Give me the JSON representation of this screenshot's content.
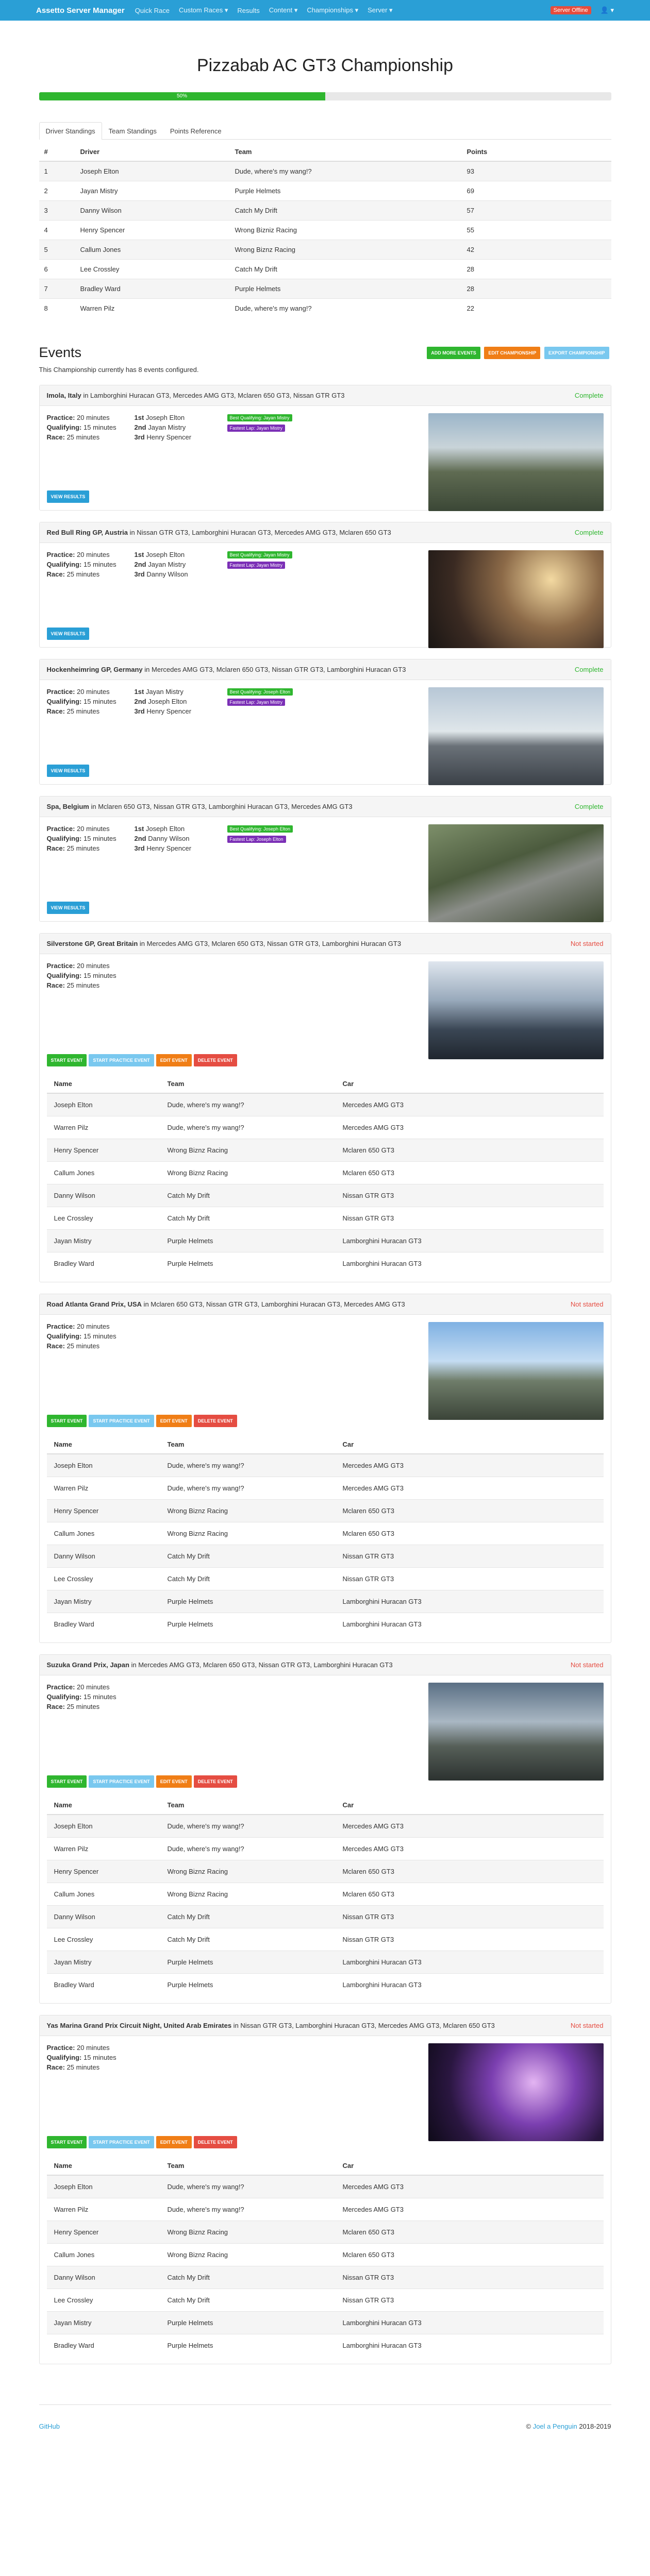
{
  "nav": {
    "brand": "Assetto Server Manager",
    "items": [
      "Quick Race",
      "Custom Races ▾",
      "Results",
      "Content ▾",
      "Championships ▾",
      "Server ▾"
    ],
    "status": "Server Offline",
    "user": "👤 ▾"
  },
  "page": {
    "title": "Pizzabab AC GT3 Championship",
    "progress_pct": 50,
    "progress_label": "50%"
  },
  "standings": {
    "tabs": [
      "Driver Standings",
      "Team Standings",
      "Points Reference"
    ],
    "headers": [
      "#",
      "Driver",
      "Team",
      "Points"
    ],
    "rows": [
      [
        "1",
        "Joseph Elton",
        "Dude, where's my wang!?",
        "93"
      ],
      [
        "2",
        "Jayan Mistry",
        "Purple Helmets",
        "69"
      ],
      [
        "3",
        "Danny Wilson",
        "Catch My Drift",
        "57"
      ],
      [
        "4",
        "Henry Spencer",
        "Wrong Bizniz Racing",
        "55"
      ],
      [
        "5",
        "Callum Jones",
        "Wrong Biznz Racing",
        "42"
      ],
      [
        "6",
        "Lee Crossley",
        "Catch My Drift",
        "28"
      ],
      [
        "7",
        "Bradley Ward",
        "Purple Helmets",
        "28"
      ],
      [
        "8",
        "Warren Pilz",
        "Dude, where's my wang!?",
        "22"
      ]
    ]
  },
  "events": {
    "title": "Events",
    "subtitle": "This Championship currently has 8 events configured.",
    "buttons": {
      "add": "Add more events",
      "edit": "Edit Championship",
      "export": "Export Championship"
    },
    "labels": {
      "practice": "Practice:",
      "qualifying": "Qualifying:",
      "race": "Race:",
      "first": "1st",
      "second": "2nd",
      "third": "3rd",
      "view_results": "View Results",
      "start_event": "Start Event",
      "start_practice": "Start Practice Event",
      "edit_event": "Edit Event",
      "delete_event": "Delete Event"
    },
    "entrant_headers": [
      "Name",
      "Team",
      "Car"
    ],
    "entrants": [
      [
        "Joseph Elton",
        "Dude, where's my wang!?",
        "Mercedes AMG GT3"
      ],
      [
        "Warren Pilz",
        "Dude, where's my wang!?",
        "Mercedes AMG GT3"
      ],
      [
        "Henry Spencer",
        "Wrong Biznz Racing",
        "Mclaren 650 GT3"
      ],
      [
        "Callum Jones",
        "Wrong Biznz Racing",
        "Mclaren 650 GT3"
      ],
      [
        "Danny Wilson",
        "Catch My Drift",
        "Nissan GTR GT3"
      ],
      [
        "Lee Crossley",
        "Catch My Drift",
        "Nissan GTR GT3"
      ],
      [
        "Jayan Mistry",
        "Purple Helmets",
        "Lamborghini Huracan GT3"
      ],
      [
        "Bradley Ward",
        "Purple Helmets",
        "Lamborghini Huracan GT3"
      ]
    ],
    "list": [
      {
        "track": "Imola, Italy",
        "cars": " in Lamborghini Huracan GT3, Mercedes AMG GT3, Mclaren 650 GT3, Nissan GTR GT3",
        "status": "Complete",
        "complete": true,
        "practice": "20 minutes",
        "qualifying": "15 minutes",
        "race": "25 minutes",
        "p1": "Joseph Elton",
        "p2": "Jayan Mistry",
        "p3": "Henry Spencer",
        "best_quali": "Best Qualifying: Jayan Mistry",
        "fastest_lap": "Fastest Lap: Jayan Mistry",
        "img": "imola"
      },
      {
        "track": "Red Bull Ring GP, Austria",
        "cars": " in Nissan GTR GT3, Lamborghini Huracan GT3, Mercedes AMG GT3, Mclaren 650 GT3",
        "status": "Complete",
        "complete": true,
        "practice": "20 minutes",
        "qualifying": "15 minutes",
        "race": "25 minutes",
        "p1": "Joseph Elton",
        "p2": "Jayan Mistry",
        "p3": "Danny Wilson",
        "best_quali": "Best Qualifying: Jayan Mistry",
        "fastest_lap": "Fastest Lap: Jayan Mistry",
        "img": "redbull"
      },
      {
        "track": "Hockenheimring GP, Germany",
        "cars": " in Mercedes AMG GT3, Mclaren 650 GT3, Nissan GTR GT3, Lamborghini Huracan GT3",
        "status": "Complete",
        "complete": true,
        "practice": "20 minutes",
        "qualifying": "15 minutes",
        "race": "25 minutes",
        "p1": "Jayan Mistry",
        "p2": "Joseph Elton",
        "p3": "Henry Spencer",
        "best_quali": "Best Qualifying: Joseph Elton",
        "fastest_lap": "Fastest Lap: Jayan Mistry",
        "img": "hockenheim"
      },
      {
        "track": "Spa, Belgium",
        "cars": " in Mclaren 650 GT3, Nissan GTR GT3, Lamborghini Huracan GT3, Mercedes AMG GT3",
        "status": "Complete",
        "complete": true,
        "practice": "20 minutes",
        "qualifying": "15 minutes",
        "race": "25 minutes",
        "p1": "Joseph Elton",
        "p2": "Danny Wilson",
        "p3": "Henry Spencer",
        "best_quali": "Best Qualifying: Joseph Elton",
        "fastest_lap": "Fastest Lap: Joseph Elton",
        "img": "spa"
      },
      {
        "track": "Silverstone GP, Great Britain",
        "cars": " in Mercedes AMG GT3, Mclaren 650 GT3, Nissan GTR GT3, Lamborghini Huracan GT3",
        "status": "Not started",
        "complete": false,
        "practice": "20 minutes",
        "qualifying": "15 minutes",
        "race": "25 minutes",
        "img": "silverstone"
      },
      {
        "track": "Road Atlanta Grand Prix, USA",
        "cars": " in Mclaren 650 GT3, Nissan GTR GT3, Lamborghini Huracan GT3, Mercedes AMG GT3",
        "status": "Not started",
        "complete": false,
        "practice": "20 minutes",
        "qualifying": "15 minutes",
        "race": "25 minutes",
        "img": "atlanta"
      },
      {
        "track": "Suzuka Grand Prix, Japan",
        "cars": " in Mercedes AMG GT3, Mclaren 650 GT3, Nissan GTR GT3, Lamborghini Huracan GT3",
        "status": "Not started",
        "complete": false,
        "practice": "20 minutes",
        "qualifying": "15 minutes",
        "race": "25 minutes",
        "img": "suzuka"
      },
      {
        "track": "Yas Marina Grand Prix Circuit Night, United Arab Emirates",
        "cars": " in Nissan GTR GT3, Lamborghini Huracan GT3, Mercedes AMG GT3, Mclaren 650 GT3",
        "status": "Not started",
        "complete": false,
        "practice": "20 minutes",
        "qualifying": "15 minutes",
        "race": "25 minutes",
        "img": "yas"
      }
    ]
  },
  "footer": {
    "link": "GitHub",
    "copy": "© ",
    "author": "Joel a Penguin",
    "years": " 2018-2019"
  }
}
